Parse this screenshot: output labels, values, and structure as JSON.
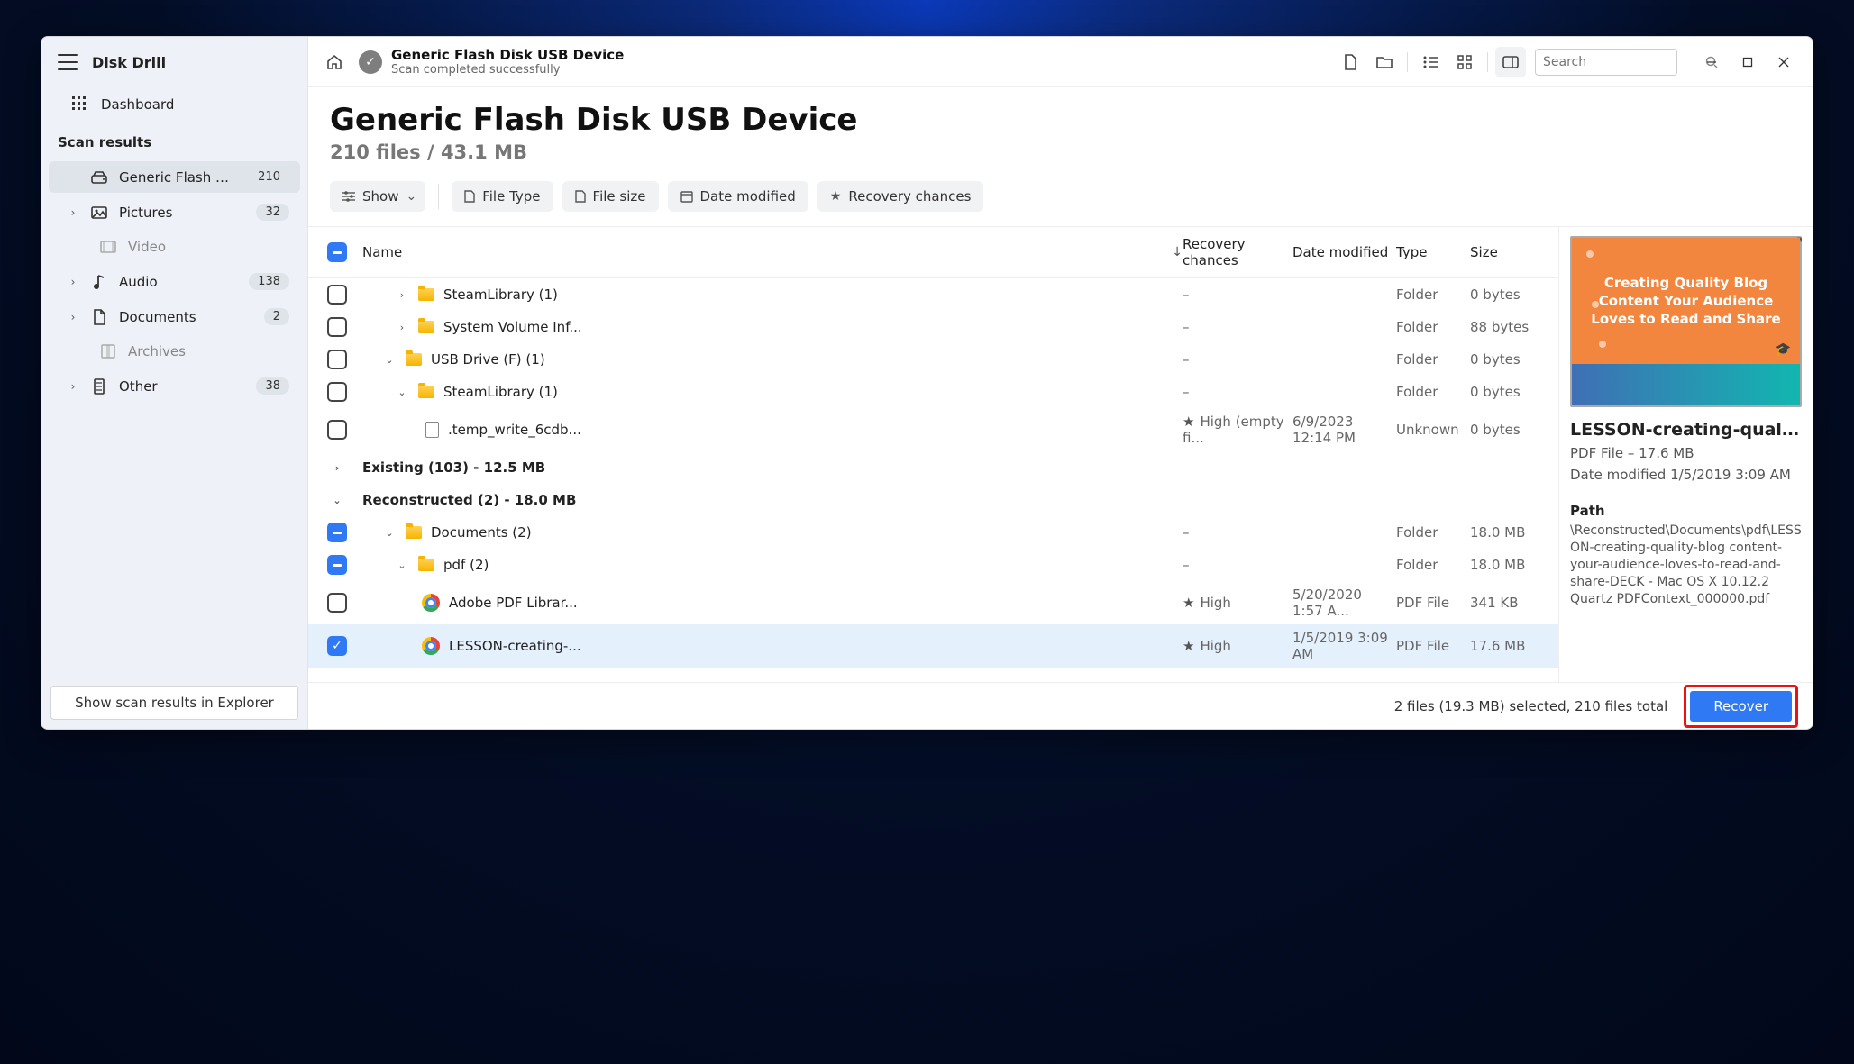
{
  "app_title": "Disk Drill",
  "dashboard_label": "Dashboard",
  "scan_results_header": "Scan results",
  "sidebar": {
    "device": {
      "label": "Generic Flash Disk USB...",
      "badge": "210"
    },
    "pictures": {
      "label": "Pictures",
      "badge": "32"
    },
    "video": {
      "label": "Video"
    },
    "audio": {
      "label": "Audio",
      "badge": "138"
    },
    "documents": {
      "label": "Documents",
      "badge": "2"
    },
    "archives": {
      "label": "Archives"
    },
    "other": {
      "label": "Other",
      "badge": "38"
    }
  },
  "show_in_explorer": "Show scan results in Explorer",
  "topbar": {
    "title": "Generic Flash Disk USB Device",
    "subtitle": "Scan completed successfully",
    "search_placeholder": "Search"
  },
  "page": {
    "title": "Generic Flash Disk USB Device",
    "subtitle": "210 files / 43.1 MB"
  },
  "filters": {
    "show": "Show",
    "filetype": "File Type",
    "filesize": "File size",
    "datemod": "Date modified",
    "recchance": "Recovery chances"
  },
  "columns": {
    "name": "Name",
    "recovery": "Recovery chances",
    "date": "Date modified",
    "type": "Type",
    "size": "Size"
  },
  "rows": {
    "r0": {
      "name": "SteamLibrary (1)",
      "rec": "–",
      "date": "",
      "type": "Folder",
      "size": "0 bytes"
    },
    "r1": {
      "name": "System Volume Inf...",
      "rec": "–",
      "date": "",
      "type": "Folder",
      "size": "88 bytes"
    },
    "r2": {
      "name": "USB Drive (F) (1)",
      "rec": "–",
      "date": "",
      "type": "Folder",
      "size": "0 bytes"
    },
    "r3": {
      "name": "SteamLibrary (1)",
      "rec": "–",
      "date": "",
      "type": "Folder",
      "size": "0 bytes"
    },
    "r4": {
      "name": ".temp_write_6cdb...",
      "rec": "High (empty fi...",
      "date": "6/9/2023 12:14 PM",
      "type": "Unknown",
      "size": "0 bytes"
    },
    "sec_existing": "Existing (103) - 12.5 MB",
    "sec_recon": "Reconstructed (2) - 18.0 MB",
    "r5": {
      "name": "Documents (2)",
      "rec": "–",
      "date": "",
      "type": "Folder",
      "size": "18.0 MB"
    },
    "r6": {
      "name": "pdf (2)",
      "rec": "–",
      "date": "",
      "type": "Folder",
      "size": "18.0 MB"
    },
    "r7": {
      "name": "Adobe PDF Librar...",
      "rec": "High",
      "date": "5/20/2020 1:57 A...",
      "type": "PDF File",
      "size": "341 KB"
    },
    "r8": {
      "name": "LESSON-creating-...",
      "rec": "High",
      "date": "1/5/2019 3:09 AM",
      "type": "PDF File",
      "size": "17.6 MB"
    }
  },
  "preview": {
    "thumb_text": "Creating Quality Blog Content Your Audience Loves to Read and Share",
    "name": "LESSON-creating-quality...",
    "meta": "PDF File – 17.6 MB",
    "date": "Date modified 1/5/2019 3:09 AM",
    "path_label": "Path",
    "path": "\\Reconstructed\\Documents\\pdf\\LESSON-creating-quality-blog content-your-audience-loves-to-read-and-share-DECK - Mac OS X 10.12.2 Quartz PDFContext_000000.pdf"
  },
  "footer": {
    "status": "2 files (19.3 MB) selected, 210 files total",
    "recover": "Recover"
  }
}
